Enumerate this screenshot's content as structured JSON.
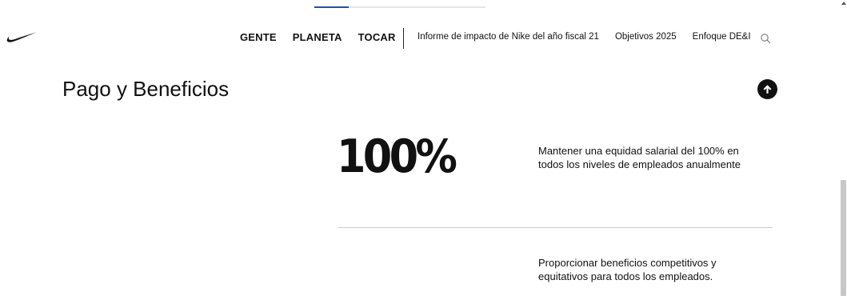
{
  "brand": {
    "logo_icon": "nike-swoosh-icon"
  },
  "progress": {
    "value": 0.2
  },
  "nav": {
    "primary": [
      {
        "label": "GENTE"
      },
      {
        "label": "PLANETA"
      },
      {
        "label": "TOCAR"
      }
    ],
    "secondary": [
      {
        "label": "Informe de impacto de Nike del año fiscal 21"
      },
      {
        "label": "Objetivos 2025"
      },
      {
        "label": "Enfoque DE&I"
      }
    ],
    "search_icon": "search-icon"
  },
  "section": {
    "title": "Pago y Beneficios",
    "scroll_top_icon": "arrow-up-icon"
  },
  "stats": [
    {
      "number": "100%",
      "description": "Mantener una equidad salarial del 100% en todos los niveles de empleados anualmente"
    },
    {
      "number": "",
      "description": "Proporcionar beneficios competitivos y equitativos para todos los empleados."
    }
  ],
  "colors": {
    "accent": "#1f4fb3",
    "text": "#111111",
    "divider": "#cccccc"
  }
}
